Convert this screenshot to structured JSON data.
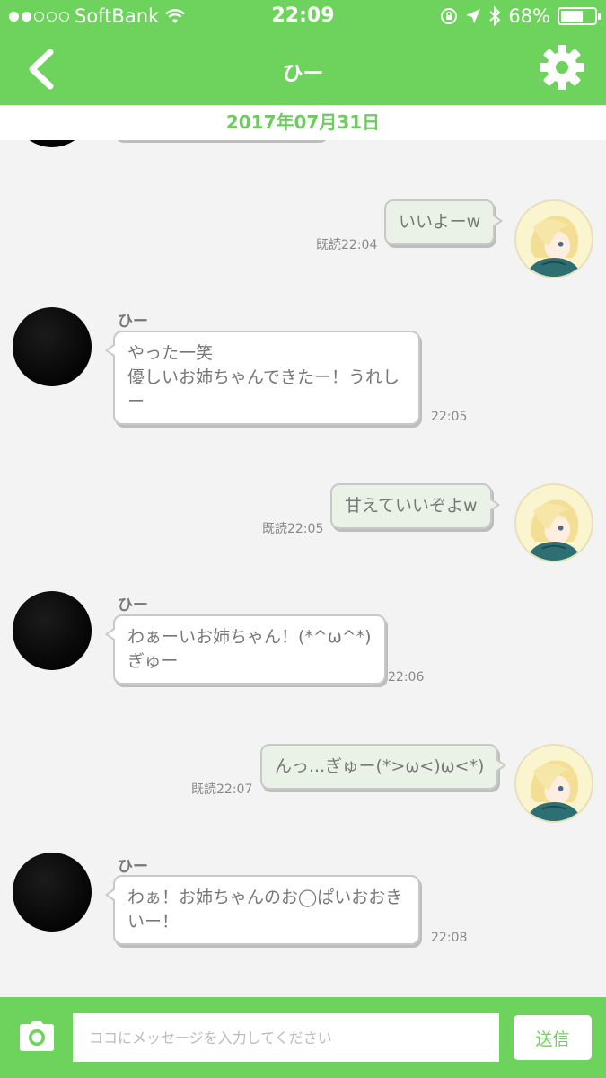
{
  "status_bar": {
    "carrier": "SoftBank",
    "time": "22:09",
    "battery": "68%",
    "battery_level": 0.68
  },
  "nav": {
    "title": "ひー",
    "back_icon": "chevron-left-icon",
    "settings_icon": "gear-icon"
  },
  "date_bar": {
    "date": "2017年07月31日"
  },
  "messages": [
    {
      "side": "out",
      "text": "いいよーw",
      "read": "既読22:04"
    },
    {
      "side": "in",
      "name": "ひー",
      "lines": [
        "やった一笑",
        "優しいお姉ちゃんできたー！うれし",
        "ー"
      ],
      "time": "22:05"
    },
    {
      "side": "out",
      "text": "甘えていいぞよw",
      "read": "既読22:05"
    },
    {
      "side": "in",
      "name": "ひー",
      "lines": [
        "わぁーいお姉ちゃん！(*^ω^*)",
        "ぎゅー"
      ],
      "time": "22:06"
    },
    {
      "side": "out",
      "text": "んっ...ぎゅー(*>ω<)ω<*)",
      "read": "既読22:07"
    },
    {
      "side": "in",
      "name": "ひー",
      "lines": [
        "わぁ！お姉ちゃんのお◯ぱいおおき",
        "いー！"
      ],
      "time": "22:08"
    }
  ],
  "input_bar": {
    "placeholder": "ココにメッセージを入力してください",
    "value": "",
    "send_label": "送信",
    "camera_icon": "camera-icon"
  },
  "colors": {
    "brand_green": "#6ed35d",
    "date_text": "#6ccc5e",
    "out_bubble": "#eaf2e7"
  }
}
